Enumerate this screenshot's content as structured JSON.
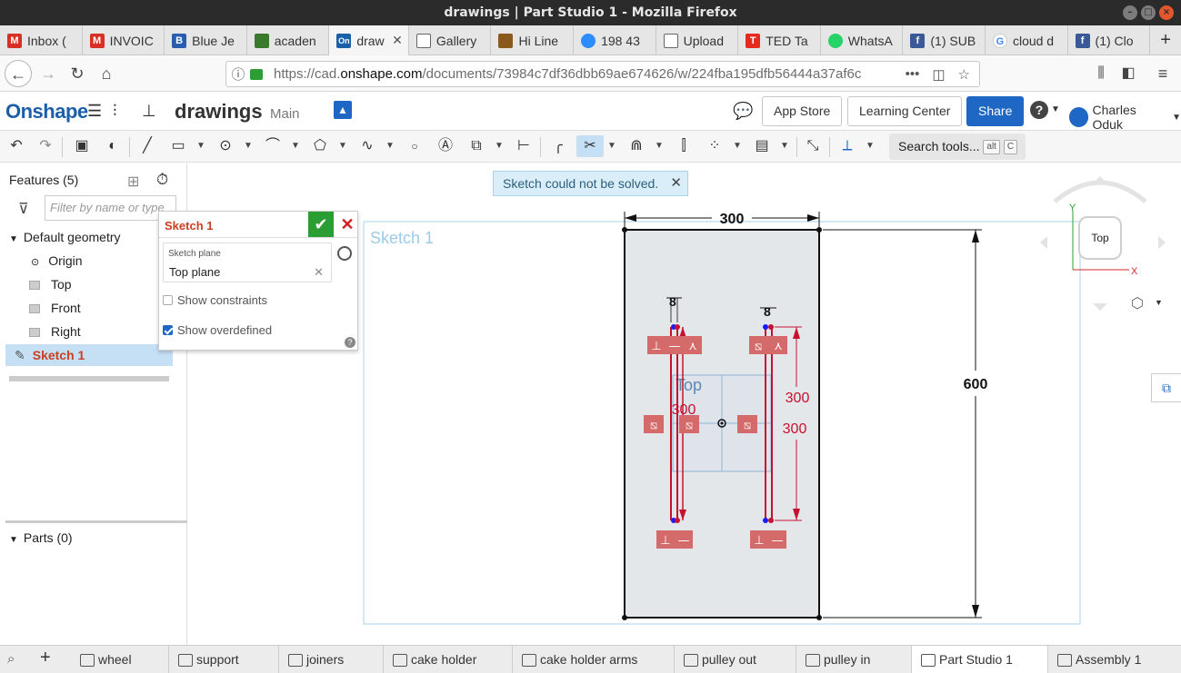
{
  "window": {
    "title": "drawings | Part Studio 1 - Mozilla Firefox"
  },
  "browser_tabs": [
    {
      "label": "Inbox (",
      "icon": "gmail-icon",
      "color": "#d93025"
    },
    {
      "label": "INVOIC",
      "icon": "gmail-icon",
      "color": "#d93025"
    },
    {
      "label": "Blue Je",
      "icon": "bluej-icon",
      "color": "#2a5db0"
    },
    {
      "label": "acaden",
      "icon": "academia-icon",
      "color": "#3a7a2c"
    },
    {
      "label": "draw",
      "icon": "onshape-icon",
      "color": "#1b5fa8"
    },
    {
      "label": "Gallery",
      "icon": "cube-icon",
      "color": "#444444"
    },
    {
      "label": "Hi Line",
      "icon": "box-icon",
      "color": "#8a5a1c"
    },
    {
      "label": "198 43",
      "icon": "zoom-icon",
      "color": "#2d8cff"
    },
    {
      "label": "Upload",
      "icon": "cube-icon",
      "color": "#444444"
    },
    {
      "label": "TED Ta",
      "icon": "ted-icon",
      "color": "#e62b1e"
    },
    {
      "label": "WhatsA",
      "icon": "whatsapp-icon",
      "color": "#25d366"
    },
    {
      "label": "(1) SUB",
      "icon": "facebook-icon",
      "color": "#3b5998"
    },
    {
      "label": "cloud d",
      "icon": "google-icon",
      "color": "#4285f4"
    },
    {
      "label": "(1) Clo",
      "icon": "facebook-icon",
      "color": "#3b5998"
    }
  ],
  "tab_icon_glyphs": [
    "M",
    "M",
    "B",
    "",
    "On",
    "",
    "",
    "",
    "",
    "T",
    "",
    "f",
    "G",
    "f"
  ],
  "active_tab_close": "✕",
  "new_tab": "+",
  "nav": {
    "url_prefix": "https://cad.",
    "url_domain": "onshape.com",
    "url_rest": "/documents/73984c7df36dbb69ae674626/w/224fba195dfb56444a37af6c",
    "more": "•••"
  },
  "header": {
    "logo": "Onshape",
    "doc_name": "drawings",
    "branch": "Main",
    "app_store": "App Store",
    "learning_center": "Learning Center",
    "share": "Share",
    "help": "?",
    "user": "Charles Oduk"
  },
  "toolbar": {
    "search_label": "Search tools...",
    "kbd1": "alt",
    "kbd2": "C"
  },
  "features": {
    "title": "Features (5)",
    "filter_placeholder": "Filter by name or type",
    "default_geometry": "Default geometry",
    "items": [
      "Origin",
      "Top",
      "Front",
      "Right"
    ],
    "sketch": "Sketch 1",
    "parts": "Parts (0)"
  },
  "sketch_dialog": {
    "title": "Sketch 1",
    "plane_label": "Sketch plane",
    "plane_value": "Top plane",
    "show_constraints": "Show constraints",
    "show_overdefined": "Show overdefined",
    "show_constraints_checked": false,
    "show_overdefined_checked": true
  },
  "notification": {
    "text": "Sketch could not be solved.",
    "close": "✕"
  },
  "canvas": {
    "sketch_label": "Sketch 1",
    "plane_label": "Top",
    "dim_width": "300",
    "dim_height": "600",
    "dim_small_left": "8",
    "dim_small_right": "8",
    "dim_300_a": "300",
    "dim_300_b": "300",
    "dim_300_c": "300"
  },
  "viewcube": {
    "face": "Top",
    "y": "Y",
    "x": "X"
  },
  "bottom_tabs": [
    "wheel",
    "support",
    "joiners",
    "cake holder",
    "cake holder arms",
    "pulley out",
    "pulley in",
    "Part Studio 1",
    "Assembly 1"
  ],
  "colors": {
    "accent": "#1e67c4",
    "sketch_red": "#c8102e",
    "constraint_red": "#d46a6a",
    "ok_green": "#2c9c34"
  }
}
